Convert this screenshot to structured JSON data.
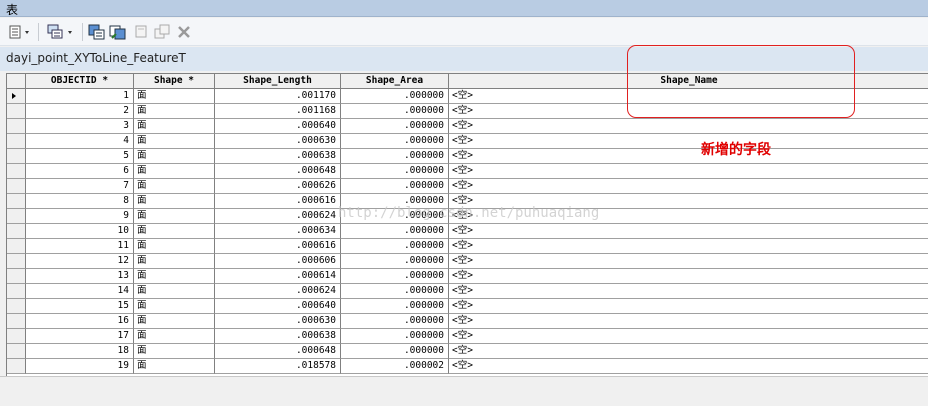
{
  "window": {
    "title": "表"
  },
  "toolbar": {
    "icons": [
      "table-options-icon",
      "related-tables-icon",
      "select-by-attributes-icon",
      "switch-selection-icon",
      "clear-selection-icon",
      "zoom-to-selected-icon",
      "delete-selected-icon"
    ]
  },
  "table_tab": {
    "name": "dayi_point_XYToLine_FeatureT"
  },
  "columns": [
    "OBJECTID *",
    "Shape *",
    "Shape_Length",
    "Shape_Area",
    "Shape_Name"
  ],
  "rows": [
    {
      "oid": "1",
      "shape": "面",
      "length": ".001170",
      "area": ".000000",
      "name": "<空>"
    },
    {
      "oid": "2",
      "shape": "面",
      "length": ".001168",
      "area": ".000000",
      "name": "<空>"
    },
    {
      "oid": "3",
      "shape": "面",
      "length": ".000640",
      "area": ".000000",
      "name": "<空>"
    },
    {
      "oid": "4",
      "shape": "面",
      "length": ".000630",
      "area": ".000000",
      "name": "<空>"
    },
    {
      "oid": "5",
      "shape": "面",
      "length": ".000638",
      "area": ".000000",
      "name": "<空>"
    },
    {
      "oid": "6",
      "shape": "面",
      "length": ".000648",
      "area": ".000000",
      "name": "<空>"
    },
    {
      "oid": "7",
      "shape": "面",
      "length": ".000626",
      "area": ".000000",
      "name": "<空>"
    },
    {
      "oid": "8",
      "shape": "面",
      "length": ".000616",
      "area": ".000000",
      "name": "<空>"
    },
    {
      "oid": "9",
      "shape": "面",
      "length": ".000624",
      "area": ".000000",
      "name": "<空>"
    },
    {
      "oid": "10",
      "shape": "面",
      "length": ".000634",
      "area": ".000000",
      "name": "<空>"
    },
    {
      "oid": "11",
      "shape": "面",
      "length": ".000616",
      "area": ".000000",
      "name": "<空>"
    },
    {
      "oid": "12",
      "shape": "面",
      "length": ".000606",
      "area": ".000000",
      "name": "<空>"
    },
    {
      "oid": "13",
      "shape": "面",
      "length": ".000614",
      "area": ".000000",
      "name": "<空>"
    },
    {
      "oid": "14",
      "shape": "面",
      "length": ".000624",
      "area": ".000000",
      "name": "<空>"
    },
    {
      "oid": "15",
      "shape": "面",
      "length": ".000640",
      "area": ".000000",
      "name": "<空>"
    },
    {
      "oid": "16",
      "shape": "面",
      "length": ".000630",
      "area": ".000000",
      "name": "<空>"
    },
    {
      "oid": "17",
      "shape": "面",
      "length": ".000638",
      "area": ".000000",
      "name": "<空>"
    },
    {
      "oid": "18",
      "shape": "面",
      "length": ".000648",
      "area": ".000000",
      "name": "<空>"
    },
    {
      "oid": "19",
      "shape": "面",
      "length": ".018578",
      "area": ".000002",
      "name": "<空>"
    }
  ],
  "annotation": {
    "text": "新增的字段",
    "color": "#e00000"
  },
  "watermark": {
    "text": "http://blog.csdn.net/puhuaqiang"
  }
}
